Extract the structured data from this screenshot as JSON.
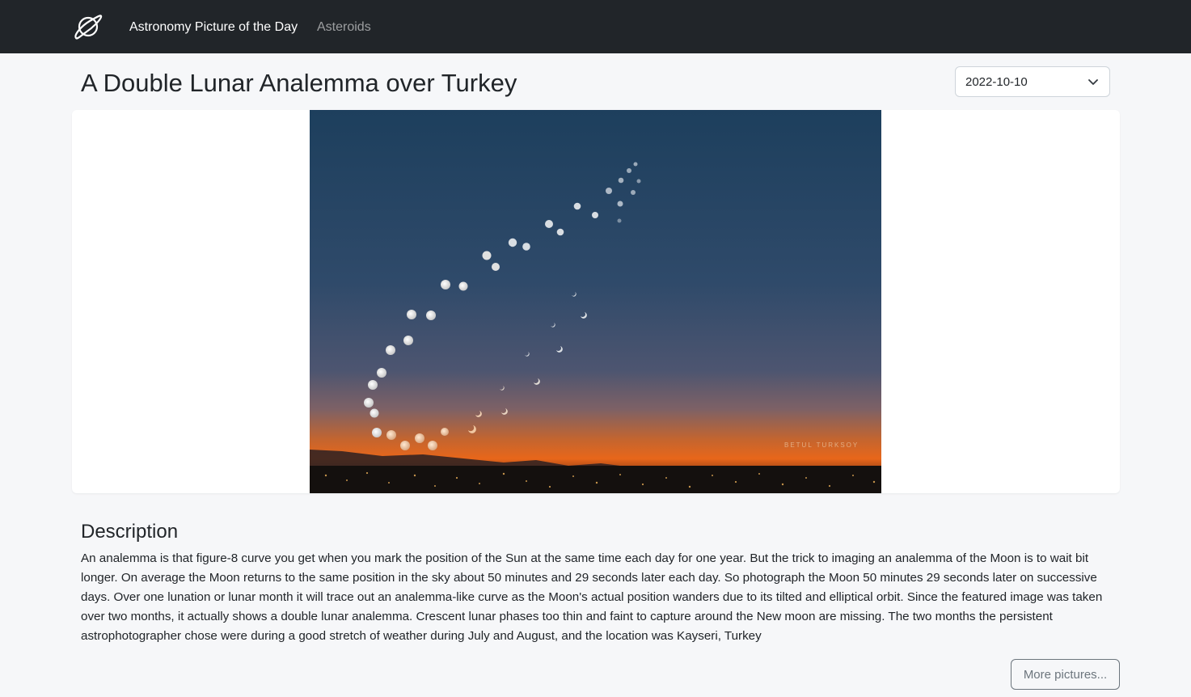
{
  "navbar": {
    "logo_icon": "planet-icon",
    "links": [
      {
        "label": "Astronomy Picture of the Day",
        "active": true
      },
      {
        "label": "Asteroids",
        "active": false
      }
    ]
  },
  "header": {
    "title": "A Double Lunar Analemma over Turkey",
    "date_select": {
      "value": "2022-10-10",
      "icon": "chevron-down-icon"
    }
  },
  "photo": {
    "watermark": "BETUL TURKSOY"
  },
  "description": {
    "heading": "Description",
    "text": "An analemma is that figure-8 curve you get when you mark the position of the Sun at the same time each day for one year. But the trick to imaging an analemma of the Moon is to wait bit longer. On average the Moon returns to the same position in the sky about 50 minutes and 29 seconds later each day. So photograph the Moon 50 minutes 29 seconds later on successive days. Over one lunation or lunar month it will trace out an analemma-like curve as the Moon's actual position wanders due to its tilted and elliptical orbit. Since the featured image was taken over two months, it actually shows a double lunar analemma. Crescent lunar phases too thin and faint to capture around the New moon are missing. The two months the persistent astrophotographer chose were during a good stretch of weather during July and August, and the location was Kayseri, Turkey"
  },
  "more_button": {
    "label": "More pictures..."
  },
  "colors": {
    "navbar_bg": "#212529",
    "page_bg": "#f6f7f9",
    "sky_top": "#1d3f5d",
    "horizon_glow": "#e8661a"
  }
}
